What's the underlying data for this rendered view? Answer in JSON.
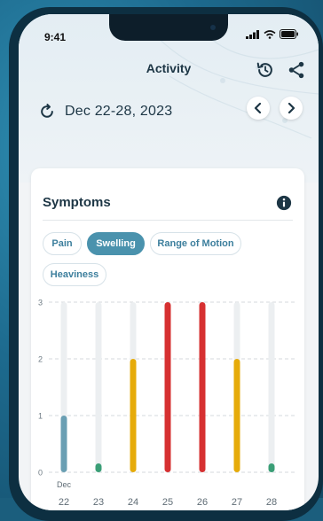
{
  "status_bar": {
    "time": "9:41"
  },
  "header": {
    "title": "Activity",
    "history_icon": "history-icon",
    "share_icon": "share-icon"
  },
  "date_range": {
    "label": "Dec 22-28, 2023",
    "refresh_icon": "refresh-icon",
    "prev_icon": "chevron-left-icon",
    "next_icon": "chevron-right-icon"
  },
  "card": {
    "title": "Symptoms",
    "info_icon": "info-icon",
    "chips": [
      {
        "label": "Pain",
        "active": false
      },
      {
        "label": "Swelling",
        "active": true
      },
      {
        "label": "Range of Motion",
        "active": false
      },
      {
        "label": "Heaviness",
        "active": false
      }
    ]
  },
  "colors": {
    "accent": "#4a92ad",
    "level1": "#6a9fb3",
    "level0": "#3a9e76",
    "level2": "#e6ab0a",
    "level3": "#d63031"
  },
  "chart_data": {
    "type": "bar",
    "categories": [
      "22",
      "23",
      "24",
      "25",
      "26",
      "27",
      "28"
    ],
    "month_label": "Dec",
    "values": [
      1,
      0,
      2,
      3,
      3,
      2,
      0
    ],
    "ylim": [
      0,
      3
    ],
    "yticks": [
      "0",
      "1",
      "2",
      "3"
    ],
    "grid": true
  }
}
